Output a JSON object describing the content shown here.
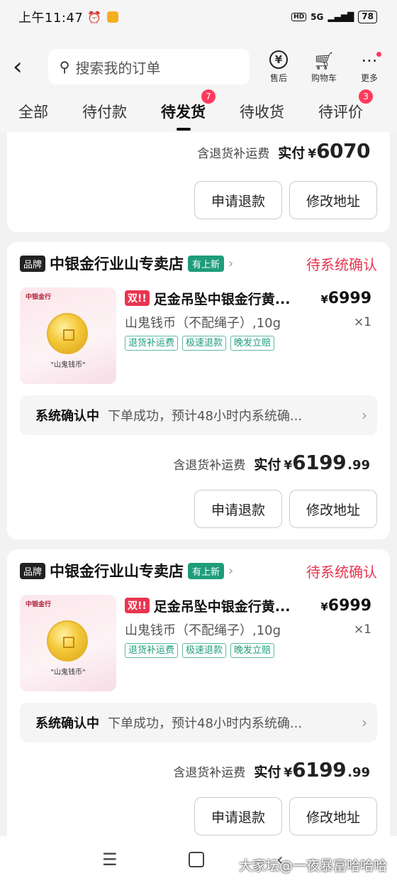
{
  "status_bar": {
    "time": "上午11:47",
    "hd": "HD",
    "network": "5G",
    "battery": "78"
  },
  "header": {
    "back_icon": "chevron-left-icon",
    "search_placeholder": "搜索我的订单",
    "actions": [
      {
        "label": "售后",
        "icon": "yen-circle-icon"
      },
      {
        "label": "购物车",
        "icon": "cart-icon"
      },
      {
        "label": "更多",
        "icon": "more-icon"
      }
    ]
  },
  "tabs": [
    {
      "label": "全部",
      "badge": ""
    },
    {
      "label": "待付款",
      "badge": ""
    },
    {
      "label": "待发货",
      "badge": "7",
      "active": true
    },
    {
      "label": "待收货",
      "badge": ""
    },
    {
      "label": "待评价",
      "badge": "3"
    }
  ],
  "top_card": {
    "note": "含退货补运费",
    "label": "实付",
    "currency": "¥",
    "amount": "6070",
    "cents": "",
    "buttons": [
      "申请退款",
      "修改地址"
    ]
  },
  "orders": [
    {
      "brand_tag": "品牌",
      "shop": "中银金行业山专卖店",
      "new_tag": "有上新",
      "status": "待系统确认",
      "item": {
        "thumb_brand": "中银金行",
        "thumb_caption": "\"山鬼钱币\"",
        "dbl_tag": "双!!",
        "title": "足金吊坠中银金行黄...",
        "price_currency": "¥",
        "price": "6999",
        "spec": "山鬼钱币（不配绳子）,10g",
        "qty": "×1",
        "services": [
          "退货补运费",
          "极速退款",
          "晚发立赔"
        ]
      },
      "sys_key": "系统确认中",
      "sys_value": "下单成功，预计48小时内系统确...",
      "note": "含退货补运费",
      "pay_label": "实付",
      "currency": "¥",
      "amount": "6199",
      "cents": ".99",
      "buttons": [
        "申请退款",
        "修改地址"
      ]
    },
    {
      "brand_tag": "品牌",
      "shop": "中银金行业山专卖店",
      "new_tag": "有上新",
      "status": "待系统确认",
      "item": {
        "thumb_brand": "中银金行",
        "thumb_caption": "\"山鬼钱币\"",
        "dbl_tag": "双!!",
        "title": "足金吊坠中银金行黄...",
        "price_currency": "¥",
        "price": "6999",
        "spec": "山鬼钱币（不配绳子）,10g",
        "qty": "×1",
        "services": [
          "退货补运费",
          "极速退款",
          "晚发立赔"
        ]
      },
      "sys_key": "系统确认中",
      "sys_value": "下单成功，预计48小时内系统确...",
      "note": "含退货补运费",
      "pay_label": "实付",
      "currency": "¥",
      "amount": "6199",
      "cents": ".99",
      "buttons": [
        "申请退款",
        "修改地址"
      ]
    }
  ],
  "watermark": "大家坛@一夜暴富哈哈哈"
}
